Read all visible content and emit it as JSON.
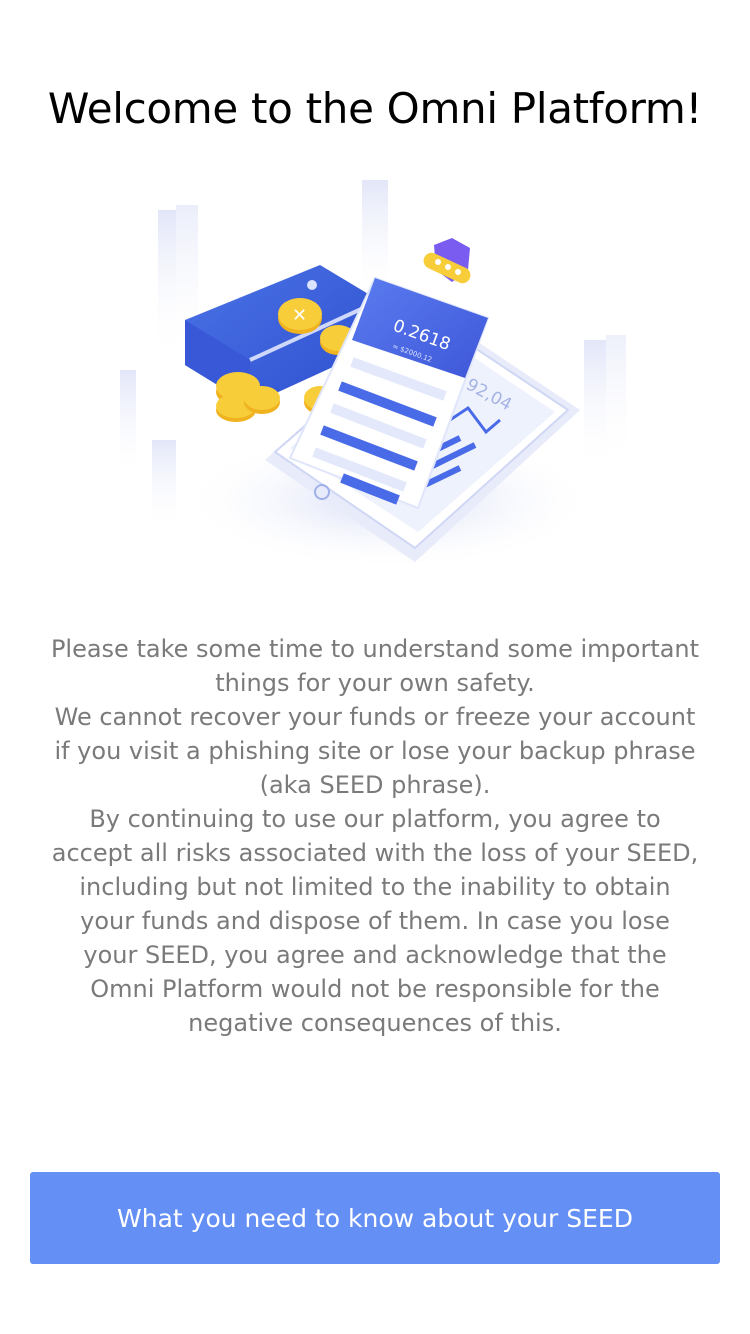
{
  "welcome": {
    "title": "Welcome to the Omni Platform!"
  },
  "illustration": {
    "phone_value": "92,04",
    "card_value": "0.2618",
    "card_subvalue": "≈ $2000.12",
    "accent_color": "#4a6be8",
    "coin_color": "#f5c02a"
  },
  "notice": {
    "paragraphs": [
      "Please take some time to understand some important things for your own safety.",
      "We cannot recover your funds or freeze your account if you visit a phishing site or lose your backup phrase (aka SEED phrase).",
      "By continuing to use our platform, you agree to accept all risks associated with the loss of your SEED, including but not limited to the inability to obtain your funds and dispose of them. In case you lose your SEED, you agree and acknowledge that the Omni Platform would not be responsible for the negative consequences of this."
    ]
  },
  "actions": {
    "seed_info_label": "What you need to know about your SEED",
    "button_color": "#648ff5"
  }
}
